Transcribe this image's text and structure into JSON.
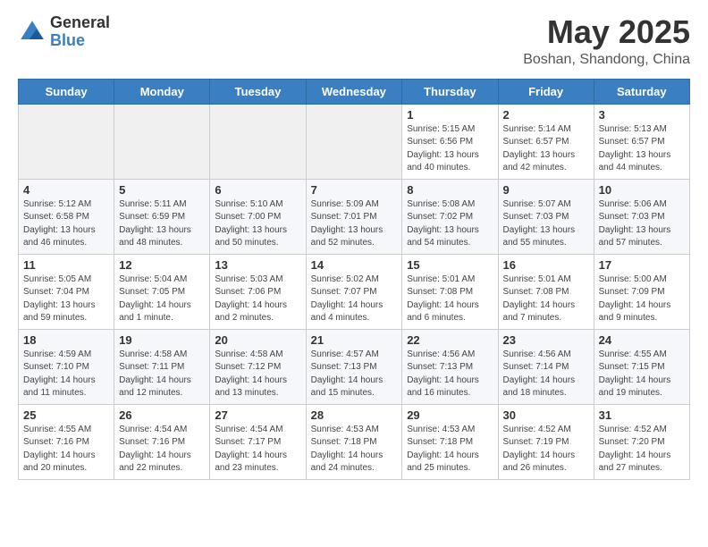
{
  "header": {
    "logo_general": "General",
    "logo_blue": "Blue",
    "month": "May 2025",
    "location": "Boshan, Shandong, China"
  },
  "days_of_week": [
    "Sunday",
    "Monday",
    "Tuesday",
    "Wednesday",
    "Thursday",
    "Friday",
    "Saturday"
  ],
  "weeks": [
    [
      {
        "day": "",
        "info": ""
      },
      {
        "day": "",
        "info": ""
      },
      {
        "day": "",
        "info": ""
      },
      {
        "day": "",
        "info": ""
      },
      {
        "day": "1",
        "info": "Sunrise: 5:15 AM\nSunset: 6:56 PM\nDaylight: 13 hours\nand 40 minutes."
      },
      {
        "day": "2",
        "info": "Sunrise: 5:14 AM\nSunset: 6:57 PM\nDaylight: 13 hours\nand 42 minutes."
      },
      {
        "day": "3",
        "info": "Sunrise: 5:13 AM\nSunset: 6:57 PM\nDaylight: 13 hours\nand 44 minutes."
      }
    ],
    [
      {
        "day": "4",
        "info": "Sunrise: 5:12 AM\nSunset: 6:58 PM\nDaylight: 13 hours\nand 46 minutes."
      },
      {
        "day": "5",
        "info": "Sunrise: 5:11 AM\nSunset: 6:59 PM\nDaylight: 13 hours\nand 48 minutes."
      },
      {
        "day": "6",
        "info": "Sunrise: 5:10 AM\nSunset: 7:00 PM\nDaylight: 13 hours\nand 50 minutes."
      },
      {
        "day": "7",
        "info": "Sunrise: 5:09 AM\nSunset: 7:01 PM\nDaylight: 13 hours\nand 52 minutes."
      },
      {
        "day": "8",
        "info": "Sunrise: 5:08 AM\nSunset: 7:02 PM\nDaylight: 13 hours\nand 54 minutes."
      },
      {
        "day": "9",
        "info": "Sunrise: 5:07 AM\nSunset: 7:03 PM\nDaylight: 13 hours\nand 55 minutes."
      },
      {
        "day": "10",
        "info": "Sunrise: 5:06 AM\nSunset: 7:03 PM\nDaylight: 13 hours\nand 57 minutes."
      }
    ],
    [
      {
        "day": "11",
        "info": "Sunrise: 5:05 AM\nSunset: 7:04 PM\nDaylight: 13 hours\nand 59 minutes."
      },
      {
        "day": "12",
        "info": "Sunrise: 5:04 AM\nSunset: 7:05 PM\nDaylight: 14 hours\nand 1 minute."
      },
      {
        "day": "13",
        "info": "Sunrise: 5:03 AM\nSunset: 7:06 PM\nDaylight: 14 hours\nand 2 minutes."
      },
      {
        "day": "14",
        "info": "Sunrise: 5:02 AM\nSunset: 7:07 PM\nDaylight: 14 hours\nand 4 minutes."
      },
      {
        "day": "15",
        "info": "Sunrise: 5:01 AM\nSunset: 7:08 PM\nDaylight: 14 hours\nand 6 minutes."
      },
      {
        "day": "16",
        "info": "Sunrise: 5:01 AM\nSunset: 7:08 PM\nDaylight: 14 hours\nand 7 minutes."
      },
      {
        "day": "17",
        "info": "Sunrise: 5:00 AM\nSunset: 7:09 PM\nDaylight: 14 hours\nand 9 minutes."
      }
    ],
    [
      {
        "day": "18",
        "info": "Sunrise: 4:59 AM\nSunset: 7:10 PM\nDaylight: 14 hours\nand 11 minutes."
      },
      {
        "day": "19",
        "info": "Sunrise: 4:58 AM\nSunset: 7:11 PM\nDaylight: 14 hours\nand 12 minutes."
      },
      {
        "day": "20",
        "info": "Sunrise: 4:58 AM\nSunset: 7:12 PM\nDaylight: 14 hours\nand 13 minutes."
      },
      {
        "day": "21",
        "info": "Sunrise: 4:57 AM\nSunset: 7:13 PM\nDaylight: 14 hours\nand 15 minutes."
      },
      {
        "day": "22",
        "info": "Sunrise: 4:56 AM\nSunset: 7:13 PM\nDaylight: 14 hours\nand 16 minutes."
      },
      {
        "day": "23",
        "info": "Sunrise: 4:56 AM\nSunset: 7:14 PM\nDaylight: 14 hours\nand 18 minutes."
      },
      {
        "day": "24",
        "info": "Sunrise: 4:55 AM\nSunset: 7:15 PM\nDaylight: 14 hours\nand 19 minutes."
      }
    ],
    [
      {
        "day": "25",
        "info": "Sunrise: 4:55 AM\nSunset: 7:16 PM\nDaylight: 14 hours\nand 20 minutes."
      },
      {
        "day": "26",
        "info": "Sunrise: 4:54 AM\nSunset: 7:16 PM\nDaylight: 14 hours\nand 22 minutes."
      },
      {
        "day": "27",
        "info": "Sunrise: 4:54 AM\nSunset: 7:17 PM\nDaylight: 14 hours\nand 23 minutes."
      },
      {
        "day": "28",
        "info": "Sunrise: 4:53 AM\nSunset: 7:18 PM\nDaylight: 14 hours\nand 24 minutes."
      },
      {
        "day": "29",
        "info": "Sunrise: 4:53 AM\nSunset: 7:18 PM\nDaylight: 14 hours\nand 25 minutes."
      },
      {
        "day": "30",
        "info": "Sunrise: 4:52 AM\nSunset: 7:19 PM\nDaylight: 14 hours\nand 26 minutes."
      },
      {
        "day": "31",
        "info": "Sunrise: 4:52 AM\nSunset: 7:20 PM\nDaylight: 14 hours\nand 27 minutes."
      }
    ]
  ]
}
